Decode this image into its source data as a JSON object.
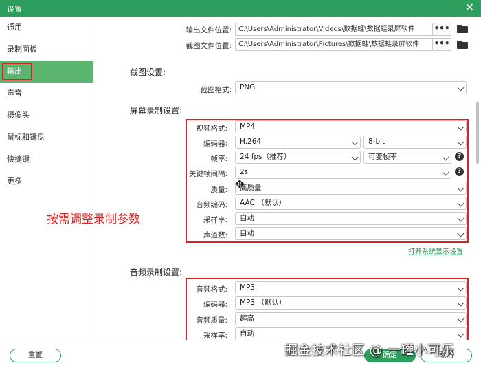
{
  "window": {
    "title": "设置",
    "close_glyph": "✕"
  },
  "sidebar": {
    "items": [
      {
        "label": "通用"
      },
      {
        "label": "录制面板"
      },
      {
        "label": "输出"
      },
      {
        "label": "声音"
      },
      {
        "label": "摄像头"
      },
      {
        "label": "鼠标和键盘"
      },
      {
        "label": "快捷键"
      },
      {
        "label": "更多"
      }
    ],
    "active_index": 2
  },
  "output": {
    "video_path_label": "输出文件位置:",
    "video_path": "C:\\Users\\Administrator\\Videos\\数据蛙\\数据蛙录屏软件",
    "screenshot_path_label": "截图文件位置:",
    "screenshot_path": "C:\\Users\\Administrator\\Pictures\\数据蛙\\数据蛙录屏软件",
    "browse_glyph": "•••"
  },
  "screenshot_settings": {
    "heading": "截图设置:",
    "format_label": "截图格式:",
    "format_value": "PNG"
  },
  "screen_recording": {
    "heading": "屏幕录制设置:",
    "video_format_label": "视频格式:",
    "video_format": "MP4",
    "encoder_label": "编码器:",
    "encoder": "H.264",
    "bit_depth": "8-bit",
    "framerate_label": "帧率:",
    "framerate": "24 fps（推荐）",
    "framerate_mode": "可变帧率",
    "keyframe_label": "关键帧间隔:",
    "keyframe": "2s",
    "quality_label": "质量:",
    "quality": "高质量",
    "audio_codec_label": "音频编码:",
    "audio_codec": "AAC （默认）",
    "sample_rate_label": "采样率:",
    "sample_rate": "自动",
    "channels_label": "声道数:",
    "channels": "自动",
    "display_link": "打开系统显示设置",
    "help_glyph": "?"
  },
  "annotation": {
    "text": "按需调整录制参数"
  },
  "audio_recording": {
    "heading": "音频录制设置:",
    "format_label": "音频格式:",
    "format": "MP3",
    "encoder_label": "编码器:",
    "encoder": "MP3 （默认）",
    "quality_label": "音频质量:",
    "quality": "超高",
    "sample_rate_label": "采样率:",
    "sample_rate": "自动"
  },
  "footer": {
    "reset_label": "重置",
    "ok_label": "确定",
    "cancel_label": "取消"
  },
  "watermark": "掘金技术社区 @ 一罐小可乐",
  "colors": {
    "accent": "#2e9e5e",
    "sidebar_active": "#5bb56f",
    "annotation": "#e02020"
  }
}
